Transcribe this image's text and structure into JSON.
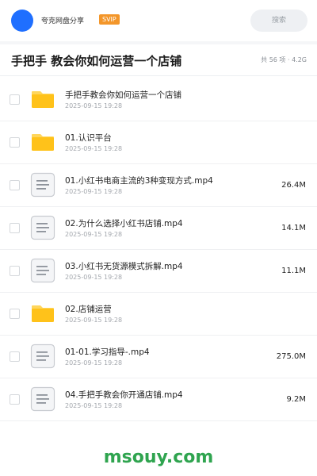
{
  "header": {
    "app_name": "夸克网盘分享",
    "badge": "SVIP",
    "search_placeholder": "搜索",
    "avatar_color": "#1f6fff"
  },
  "folder": {
    "title": "手把手 教会你如何运营一个店铺",
    "summary": "共 56 项 · 4.2G"
  },
  "items": [
    {
      "type": "folder",
      "icon": "folder-icon",
      "name": "手把手教会你如何运营一个店铺",
      "date": "2025-09-15 19:28",
      "size": ""
    },
    {
      "type": "folder",
      "icon": "folder-icon",
      "name": "01.认识平台",
      "date": "2025-09-15 19:28",
      "size": ""
    },
    {
      "type": "file",
      "icon": "document-icon",
      "name": "01.小红书电商主流的3种变现方式.mp4",
      "date": "2025-09-15 19:28",
      "size": "26.4M"
    },
    {
      "type": "file",
      "icon": "document-icon",
      "name": "02.为什么选择小红书店铺.mp4",
      "date": "2025-09-15 19:28",
      "size": "14.1M"
    },
    {
      "type": "file",
      "icon": "document-icon",
      "name": "03.小红书无货源模式拆解.mp4",
      "date": "2025-09-15 19:28",
      "size": "11.1M"
    },
    {
      "type": "folder",
      "icon": "folder-icon",
      "name": "02.店铺运营",
      "date": "2025-09-15 19:28",
      "size": ""
    },
    {
      "type": "file",
      "icon": "document-icon",
      "name": "01-01.学习指导-.mp4",
      "date": "2025-09-15 19:28",
      "size": "275.0M"
    },
    {
      "type": "file",
      "icon": "document-icon",
      "name": "04.手把手教会你开通店铺.mp4",
      "date": "2025-09-15 19:28",
      "size": "9.2M"
    }
  ],
  "watermark": "msouy.com",
  "colors": {
    "folder": "#ffc21a",
    "folder_tab": "#ffd65c",
    "svip": "#f3962a",
    "watermark": "#2fa44f"
  }
}
